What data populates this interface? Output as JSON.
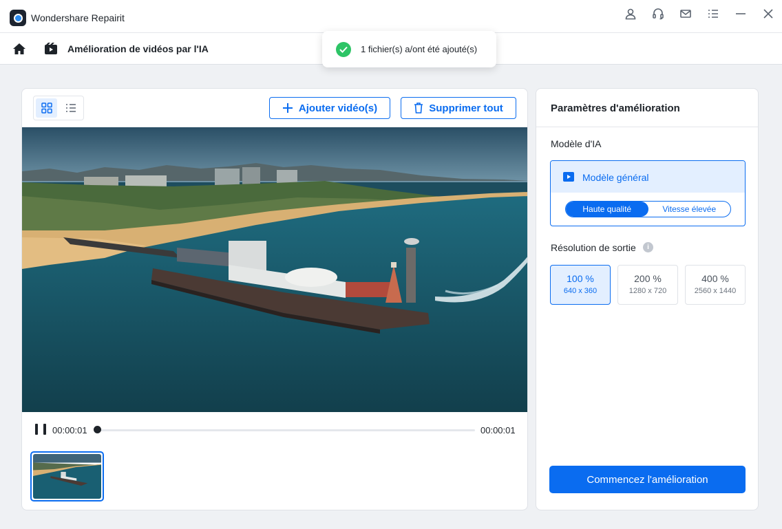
{
  "window": {
    "title": "Wondershare Repairit",
    "controls": [
      "account-icon",
      "headset-icon",
      "mail-icon",
      "menu-icon",
      "minimize-icon",
      "close-icon"
    ]
  },
  "breadcrumb": {
    "title": "Amélioration de vidéos par l'IA"
  },
  "toast": {
    "message": "1 fichier(s) a/ont été ajouté(s)"
  },
  "toolbar": {
    "add_label": "Ajouter vidéo(s)",
    "delete_label": "Supprimer tout"
  },
  "player": {
    "current_time": "00:00:01",
    "total_time": "00:00:01",
    "progress": 0
  },
  "settings": {
    "title": "Paramètres d'amélioration",
    "model_label": "Modèle d'IA",
    "model_name": "Modèle général",
    "quality_options": [
      "Haute qualité",
      "Vitesse élevée"
    ],
    "quality_selected": "Haute qualité",
    "resolution_label": "Résolution de sortie",
    "resolutions": [
      {
        "percent": "100 %",
        "size": "640 x 360",
        "selected": true
      },
      {
        "percent": "200 %",
        "size": "1280 x 720",
        "selected": false
      },
      {
        "percent": "400 %",
        "size": "2560 x 1440",
        "selected": false
      }
    ],
    "start_label": "Commencez l'amélioration"
  },
  "colors": {
    "accent": "#0a6cf0",
    "accent_light": "#e3efff",
    "success": "#2dc466"
  }
}
